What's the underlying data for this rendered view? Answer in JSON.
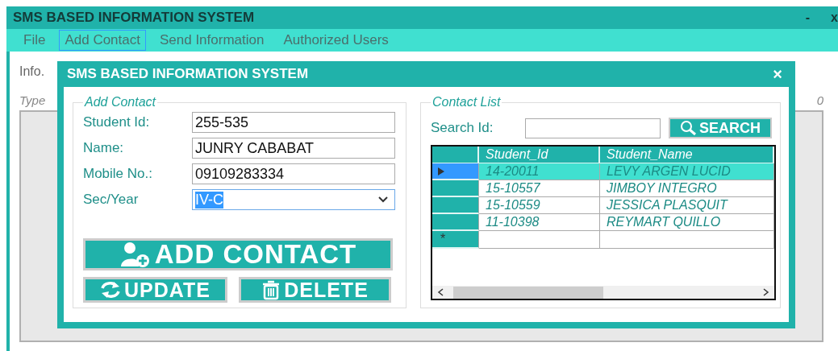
{
  "window": {
    "title": "SMS BASED INFORMATION SYSTEM",
    "controls": [
      "-",
      "x"
    ]
  },
  "menu": [
    {
      "label": "File",
      "selected": false
    },
    {
      "label": "Add Contact",
      "selected": true
    },
    {
      "label": "Send Information",
      "selected": false
    },
    {
      "label": "Authorized Users",
      "selected": false
    }
  ],
  "main": {
    "info_label": "Info.",
    "type_label": "Type",
    "count": "0"
  },
  "dialog": {
    "title": "SMS BASED INFORMATION SYSTEM",
    "close": "×",
    "add_contact": {
      "legend": "Add Contact",
      "fields": [
        {
          "label": "Student Id:",
          "value": "255-535",
          "kind": "text",
          "focused": false
        },
        {
          "label": "Name:",
          "value": "JUNRY CABABAT",
          "kind": "text",
          "focused": false
        },
        {
          "label": "Mobile No.:",
          "value": "09109283334",
          "kind": "text",
          "focused": false
        },
        {
          "label": "Sec/Year",
          "value": "IV-C",
          "kind": "dropdown",
          "focused": true
        }
      ],
      "buttons": [
        {
          "label": "ADD CONTACT",
          "kind": "add-user"
        },
        {
          "label": "UPDATE",
          "kind": "refresh"
        },
        {
          "label": "DELETE",
          "kind": "trash"
        }
      ]
    },
    "contact_list": {
      "legend": "Contact List",
      "search_label": "Search Id:",
      "search_button": "SEARCH",
      "columns": [
        "Student_Id",
        "Student_Name"
      ],
      "rows": [
        {
          "cells": [
            "14-20011",
            "LEVY ARGEN LUCID"
          ],
          "selected": true
        },
        {
          "cells": [
            "15-10557",
            "JIMBOY INTEGRO"
          ],
          "selected": false
        },
        {
          "cells": [
            "15-10559",
            "JESSICA PLASQUIT"
          ],
          "selected": false
        },
        {
          "cells": [
            "11-10398",
            "REYMART QUILLO"
          ],
          "selected": false
        }
      ],
      "new_row_marker": "*"
    }
  }
}
